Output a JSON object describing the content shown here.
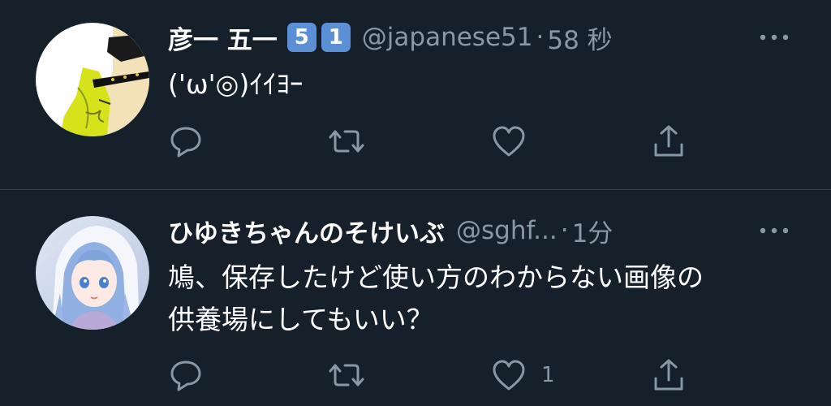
{
  "tweets": [
    {
      "display_name": "彦一 五一",
      "badges": [
        "5",
        "1"
      ],
      "handle": "@japanese51",
      "separator": "·",
      "time": "58 秒",
      "text": "('ω'◎)ｲｲﾖｰ",
      "like_count": "",
      "avatar_icon": "avatar-drawing-icon"
    },
    {
      "display_name": "ひゆきちゃんのそけいぶ",
      "handle": "@sghf...",
      "separator": "·",
      "time": "1分",
      "text_lines": [
        "鳩、保存したけど使い方のわからない画像の",
        "供養場にしてもいい？"
      ],
      "like_count": "1",
      "avatar_icon": "avatar-anime-girl-icon"
    }
  ],
  "colors": {
    "background": "#15202b",
    "divider": "#38444d",
    "secondary_text": "#8899a6",
    "badge": "#5b8fd6"
  }
}
